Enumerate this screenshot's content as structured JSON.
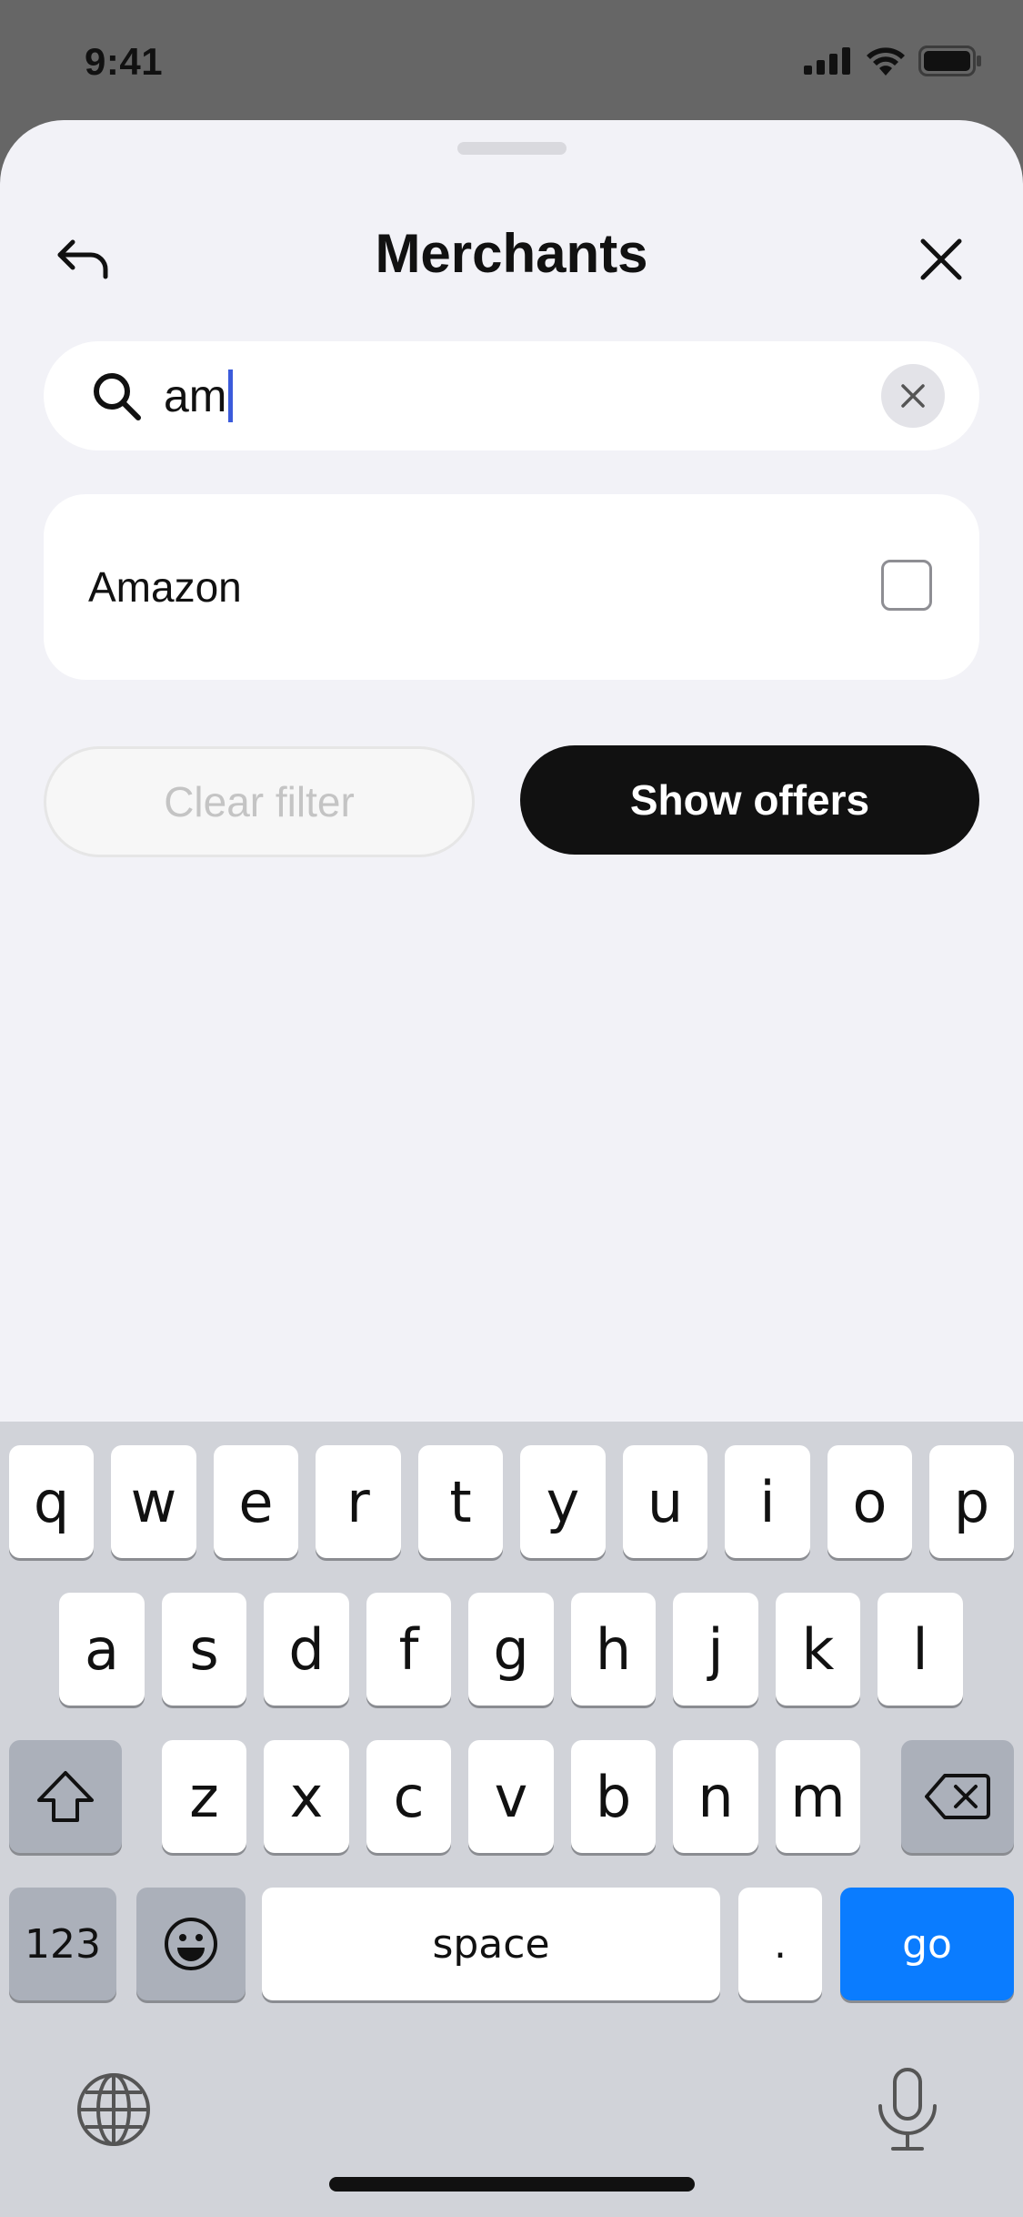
{
  "status_bar": {
    "time": "9:41",
    "icons": [
      "signal-icon",
      "wifi-icon",
      "battery-icon"
    ]
  },
  "header": {
    "title": "Merchants",
    "back_icon": "back-arrow-icon",
    "close_icon": "close-icon"
  },
  "search": {
    "value": "am",
    "icon": "search-icon",
    "clear_icon": "clear-icon"
  },
  "results": [
    {
      "label": "Amazon",
      "checked": false
    }
  ],
  "actions": {
    "clear_label": "Clear filter",
    "show_label": "Show offers"
  },
  "keyboard": {
    "row1": [
      "q",
      "w",
      "e",
      "r",
      "t",
      "y",
      "u",
      "i",
      "o",
      "p"
    ],
    "row2": [
      "a",
      "s",
      "d",
      "f",
      "g",
      "h",
      "j",
      "k",
      "l"
    ],
    "row3": [
      "z",
      "x",
      "c",
      "v",
      "b",
      "n",
      "m"
    ],
    "numbers_label": "123",
    "space_label": "space",
    "period_label": ".",
    "go_label": "go",
    "icons": [
      "shift-icon",
      "backspace-icon",
      "emoji-icon",
      "globe-icon",
      "microphone-icon"
    ]
  },
  "colors": {
    "accent_blue": "#0a7cff",
    "caret": "#3b5bdb",
    "primary_button": "#111111",
    "sheet_bg": "#f2f2f7"
  }
}
